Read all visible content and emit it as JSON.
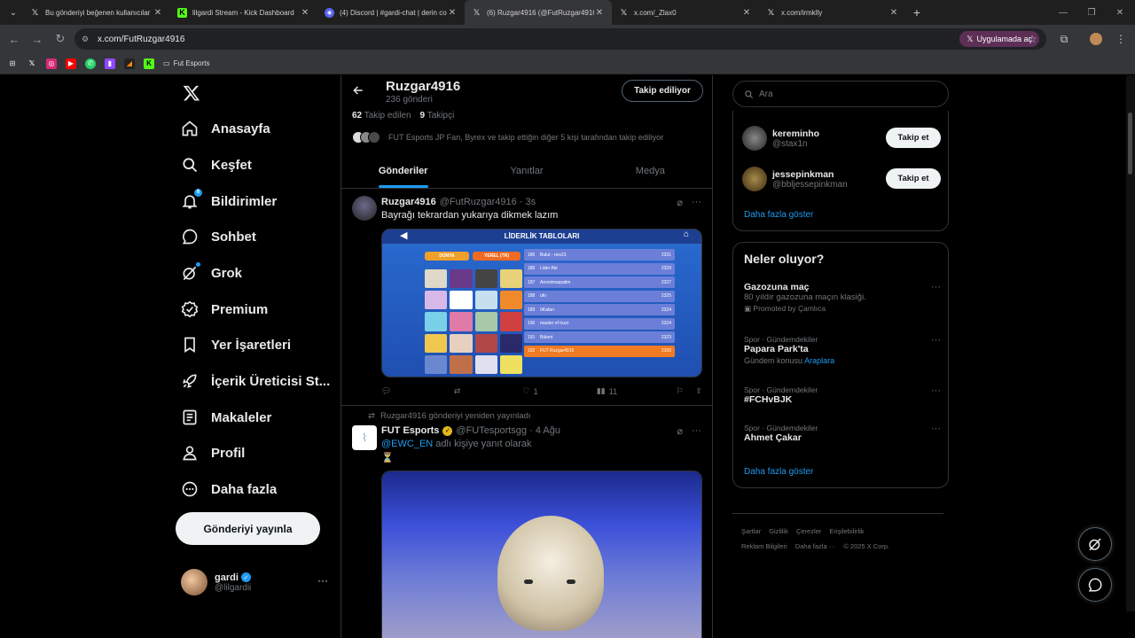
{
  "browser": {
    "tabs": [
      {
        "title": "Bu gönderiyi beğenen kullanıcılar",
        "icon": "x-icon"
      },
      {
        "title": "lilgardi Stream - Kick Dashboard",
        "icon": "kick-icon"
      },
      {
        "title": "(4) Discord | #gardi-chat | derin co",
        "icon": "discord-icon"
      },
      {
        "title": "(6) Ruzgar4916 (@FutRuzgar4916)",
        "icon": "x-icon"
      },
      {
        "title": "x.com/_Zlax0",
        "icon": "x-icon"
      },
      {
        "title": "x.com/irmklly",
        "icon": "x-icon"
      }
    ],
    "active_tab": 3,
    "url": "x.com/FutRuzgar4916",
    "open_in_app": "Uygulamada aç",
    "bookmark_folder": "Fut Esports"
  },
  "nav": {
    "items": [
      {
        "label": "Anasayfa",
        "icon": "home-icon"
      },
      {
        "label": "Keşfet",
        "icon": "search-icon"
      },
      {
        "label": "Bildirimler",
        "icon": "bell-icon",
        "badge": "6"
      },
      {
        "label": "Sohbet",
        "icon": "chat-icon"
      },
      {
        "label": "Grok",
        "icon": "grok-icon"
      },
      {
        "label": "Premium",
        "icon": "premium-icon"
      },
      {
        "label": "Yer İşaretleri",
        "icon": "bookmark-icon"
      },
      {
        "label": "İçerik Üreticisi St...",
        "icon": "rocket-icon"
      },
      {
        "label": "Makaleler",
        "icon": "article-icon"
      },
      {
        "label": "Profil",
        "icon": "person-icon"
      },
      {
        "label": "Daha fazla",
        "icon": "more-circle-icon"
      }
    ],
    "post_button": "Gönderiyi yayınla",
    "account": {
      "name": "gardi",
      "handle": "@lilgardii"
    }
  },
  "profile": {
    "name": "Ruzgar4916",
    "post_count": "236 gönderi",
    "follow_button": "Takip ediliyor",
    "following_count": "62",
    "following_label": "Takip edilen",
    "followers_count": "9",
    "followers_label": "Takipçi",
    "followed_by": "FUT Esports JP Fan, Byrex ve takip ettiğin diğer 5 kişi tarafından takip ediliyor",
    "tabs": [
      "Gönderiler",
      "Yanıtlar",
      "Medya"
    ]
  },
  "tweets": [
    {
      "name": "Ruzgar4916",
      "meta": "@FutRuzgar4916 · 3s",
      "text": "Bayrağı tekrardan yukarıya dikmek lazım",
      "media_title": "LİDERLİK TABLOLARI",
      "tab_world": "DÜNYA",
      "tab_local": "YEREL (TR)",
      "leaderboard": [
        {
          "rank": "185",
          "name": "Bulut - reis23",
          "score": "2331"
        },
        {
          "rank": "186",
          "name": "Lider Abi",
          "score": "2329"
        },
        {
          "rank": "187",
          "name": "Anonimaspatim",
          "score": "2327"
        },
        {
          "rank": "188",
          "name": "ufo",
          "score": "2325"
        },
        {
          "rank": "189",
          "name": "0Kafan",
          "score": "2324"
        },
        {
          "rank": "190",
          "name": "master of trust",
          "score": "2324"
        },
        {
          "rank": "191",
          "name": "Bülent",
          "score": "2323"
        },
        {
          "rank": "192",
          "name": "FUT Ruzgar4916",
          "score": "2100"
        }
      ],
      "reply_count": "",
      "retweet_count": "",
      "like_count": "1",
      "view_count": "11"
    },
    {
      "retweet_label": "Ruzgar4916 gönderiyi yeniden yayınladı",
      "name": "FUT Esports",
      "meta": "@FUTesportsgg · 4 Ağu",
      "reply_to_user": "@EWC_EN",
      "reply_to_suffix": "adlı kişiye yanıt olarak",
      "text": "⏳"
    }
  ],
  "sidebar": {
    "search_placeholder": "Ara",
    "who_to_follow": [
      {
        "name": "kereminho",
        "handle": "@stax1n",
        "button": "Takip et"
      },
      {
        "name": "jessepinkman",
        "handle": "@bbljessepinkman",
        "button": "Takip et"
      }
    ],
    "show_more": "Daha fazla göster",
    "trends_title": "Neler oluyor?",
    "trends": [
      {
        "top": "",
        "title": "Gazozuna maç",
        "sub": "80 yıldır gazozuna maçın klasiği.",
        "promo": "Promoted by Çamlıca"
      },
      {
        "top": "Spor · Gündemdekiler",
        "title": "Papara Park'ta",
        "sub": "Gündem konusu",
        "link": "Araplara"
      },
      {
        "top": "Spor · Gündemdekiler",
        "title": "#FCHvBJK",
        "sub": ""
      },
      {
        "top": "Spor · Gündemdekiler",
        "title": "Ahmet Çakar",
        "sub": ""
      }
    ],
    "trends_show_more": "Daha fazla göster",
    "footer": [
      "Şartlar",
      "Gizlilik",
      "Çerezler",
      "Erişilebilirlik",
      "Reklam Bilgileri",
      "Daha fazla ···",
      "© 2025 X Corp."
    ]
  },
  "colors": {
    "accent": "#1d9bf0",
    "background": "#000000",
    "text": "#e7e9ea",
    "muted": "#71767b"
  }
}
